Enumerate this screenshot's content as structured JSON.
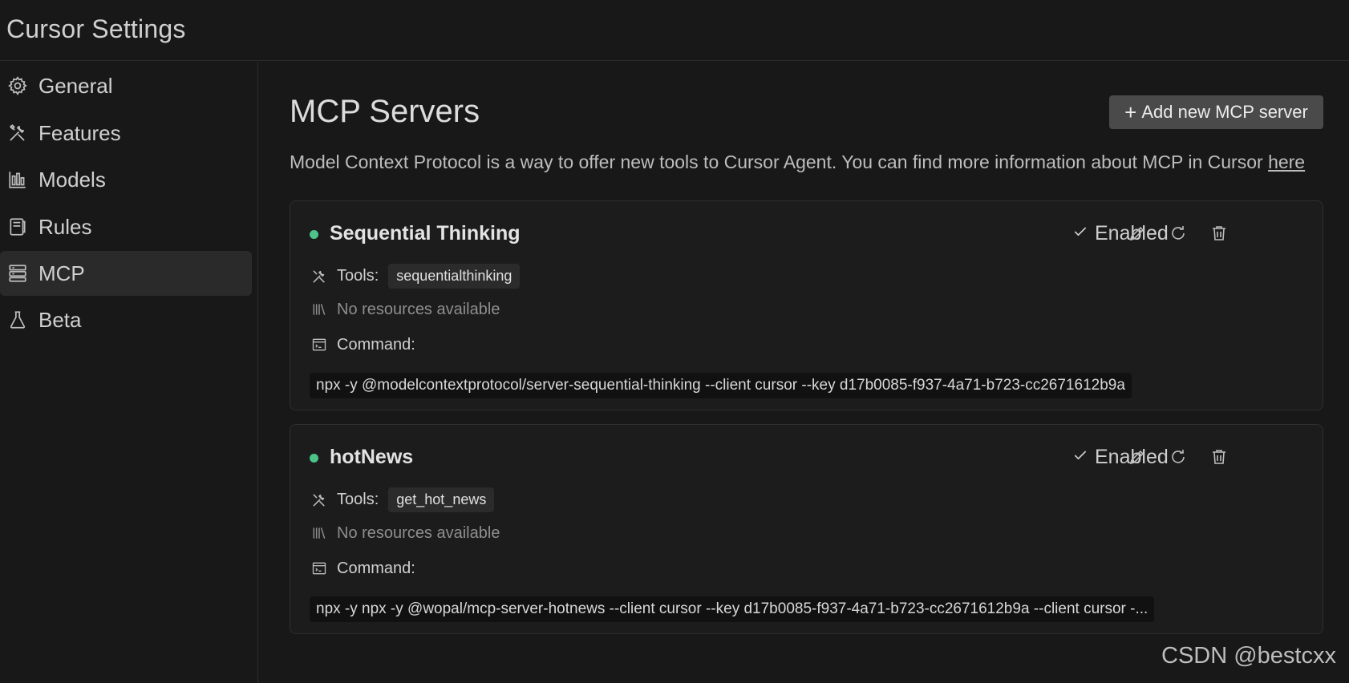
{
  "window": {
    "title": "Cursor Settings"
  },
  "sidebar": {
    "items": [
      {
        "label": "General",
        "icon": "gear-icon",
        "active": false
      },
      {
        "label": "Features",
        "icon": "tools-icon",
        "active": false
      },
      {
        "label": "Models",
        "icon": "bar-chart-icon",
        "active": false
      },
      {
        "label": "Rules",
        "icon": "book-icon",
        "active": false
      },
      {
        "label": "MCP",
        "icon": "server-icon",
        "active": true
      },
      {
        "label": "Beta",
        "icon": "flask-icon",
        "active": false
      }
    ]
  },
  "main": {
    "title": "MCP Servers",
    "add_button": {
      "icon": "plus",
      "label": "Add new MCP server"
    },
    "intro_text": "Model Context Protocol is a way to offer new tools to Cursor Agent. You can find more information about MCP in Cursor ",
    "intro_link": "here",
    "servers": [
      {
        "name": "Sequential Thinking",
        "status": "Enabled",
        "status_color": "#4cc38a",
        "tools_label": "Tools:",
        "tools": [
          "sequentialthinking"
        ],
        "resources_text": "No resources available",
        "command_label": "Command:",
        "command": "npx -y @modelcontextprotocol/server-sequential-thinking --client cursor --key d17b0085-f937-4a71-b723-cc2671612b9a"
      },
      {
        "name": "hotNews",
        "status": "Enabled",
        "status_color": "#4cc38a",
        "tools_label": "Tools:",
        "tools": [
          "get_hot_news"
        ],
        "resources_text": "No resources available",
        "command_label": "Command:",
        "command": "npx -y npx -y @wopal/mcp-server-hotnews --client cursor --key d17b0085-f937-4a71-b723-cc2671612b9a --client cursor -..."
      }
    ]
  },
  "watermark": "CSDN @bestcxx",
  "colors": {
    "background": "#181818",
    "accent_green": "#4cc38a",
    "button_bg": "#4a4a4a"
  }
}
